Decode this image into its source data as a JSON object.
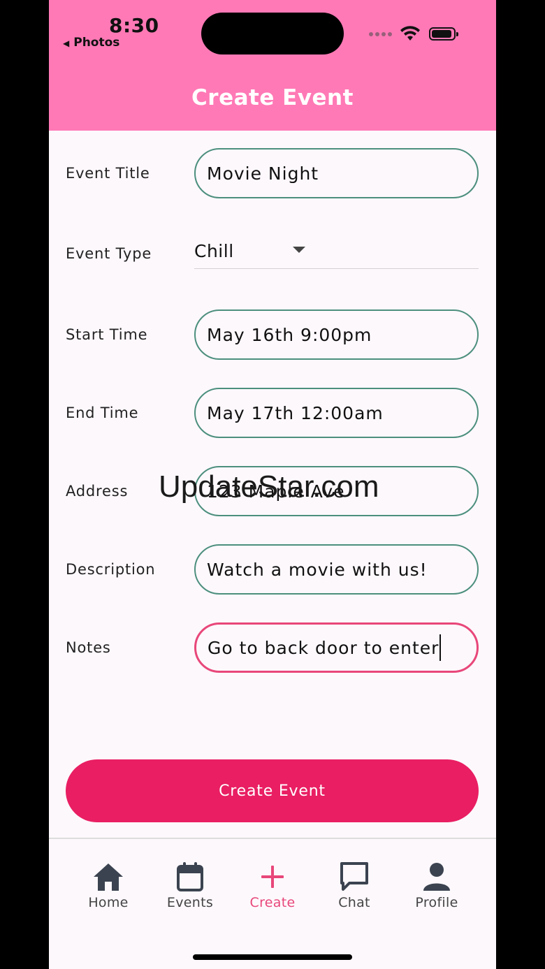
{
  "status": {
    "time": "8:30",
    "back_label": "Photos"
  },
  "header": {
    "title": "Create Event"
  },
  "form": {
    "event_title": {
      "label": "Event Title",
      "value": "Movie Night"
    },
    "event_type": {
      "label": "Event Type",
      "value": "Chill"
    },
    "start_time": {
      "label": "Start Time",
      "value": "May 16th 9:00pm"
    },
    "end_time": {
      "label": "End Time",
      "value": "May 17th 12:00am"
    },
    "address": {
      "label": "Address",
      "value": "123 Maple Ave"
    },
    "description": {
      "label": "Description",
      "value": "Watch a movie with us!"
    },
    "notes": {
      "label": "Notes",
      "value": "Go to back door to enter"
    }
  },
  "watermark": "UpdateStar.com",
  "submit_label": "Create Event",
  "nav": {
    "items": [
      {
        "label": "Home",
        "icon": "home-icon"
      },
      {
        "label": "Events",
        "icon": "calendar-icon"
      },
      {
        "label": "Create",
        "icon": "plus-icon"
      },
      {
        "label": "Chat",
        "icon": "chat-icon"
      },
      {
        "label": "Profile",
        "icon": "person-icon"
      }
    ],
    "active_index": 2
  },
  "colors": {
    "header": "#ff79b6",
    "field_border": "#4c8f7d",
    "focus_border": "#e8477a",
    "primary_button": "#e91e63"
  }
}
